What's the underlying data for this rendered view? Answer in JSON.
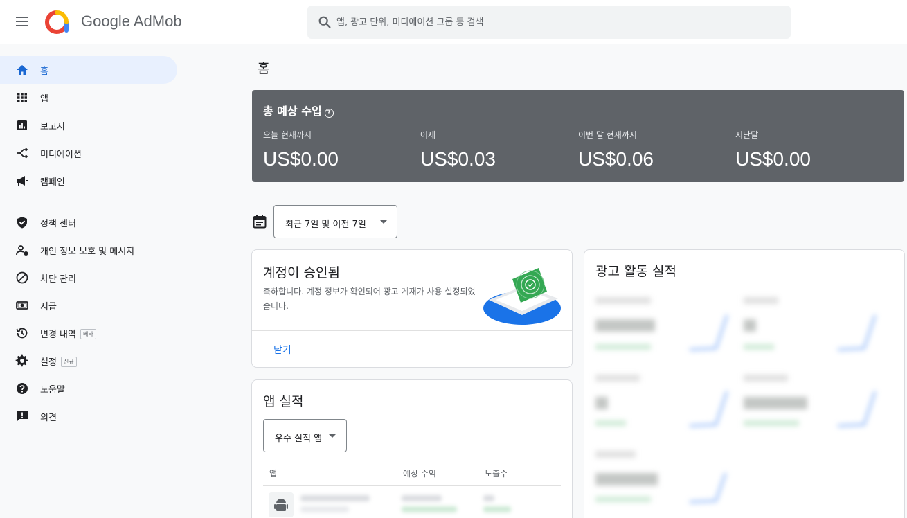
{
  "header": {
    "brand": "Google AdMob",
    "search_placeholder": "앱, 광고 단위, 미디에이션 그룹 등 검색"
  },
  "sidebar": {
    "items": [
      {
        "label": "홈",
        "icon": "home-icon",
        "active": true
      },
      {
        "label": "앱",
        "icon": "apps-grid-icon"
      },
      {
        "label": "보고서",
        "icon": "report-icon"
      },
      {
        "label": "미디에이션",
        "icon": "mediation-icon"
      },
      {
        "label": "캠페인",
        "icon": "megaphone-icon"
      },
      {
        "label": "정책 센터",
        "icon": "shield-icon"
      },
      {
        "label": "개인 정보 보호 및 메시지",
        "icon": "privacy-icon"
      },
      {
        "label": "차단 관리",
        "icon": "block-icon"
      },
      {
        "label": "지급",
        "icon": "payment-icon"
      },
      {
        "label": "변경 내역",
        "icon": "history-icon",
        "badge": "베타"
      },
      {
        "label": "설정",
        "icon": "gear-icon",
        "badge": "신규"
      },
      {
        "label": "도움말",
        "icon": "help-icon"
      },
      {
        "label": "의견",
        "icon": "feedback-icon"
      }
    ]
  },
  "page": {
    "title": "홈"
  },
  "earnings": {
    "title": "총 예상 수입",
    "metrics": [
      {
        "label": "오늘 현재까지",
        "value": "US$0.00"
      },
      {
        "label": "어제",
        "value": "US$0.03"
      },
      {
        "label": "이번 달 현재까지",
        "value": "US$0.06"
      },
      {
        "label": "지난달",
        "value": "US$0.00"
      }
    ]
  },
  "date_range": {
    "selected": "최근 7일 및 이전 7일"
  },
  "approval_card": {
    "title": "계정이 승인됨",
    "body": "축하합니다. 계정 정보가 확인되어 광고 게재가 사용 설정되었습니다.",
    "close_label": "닫기"
  },
  "app_performance": {
    "title": "앱 실적",
    "filter": "우수 실적 앱",
    "columns": [
      "앱",
      "예상 수익",
      "노출수"
    ]
  },
  "ad_activity": {
    "title": "광고 활동 실적"
  },
  "colors": {
    "accent": "#1a73e8",
    "earnings_bg": "#5f6368",
    "active_bg": "#e8f0fe"
  }
}
